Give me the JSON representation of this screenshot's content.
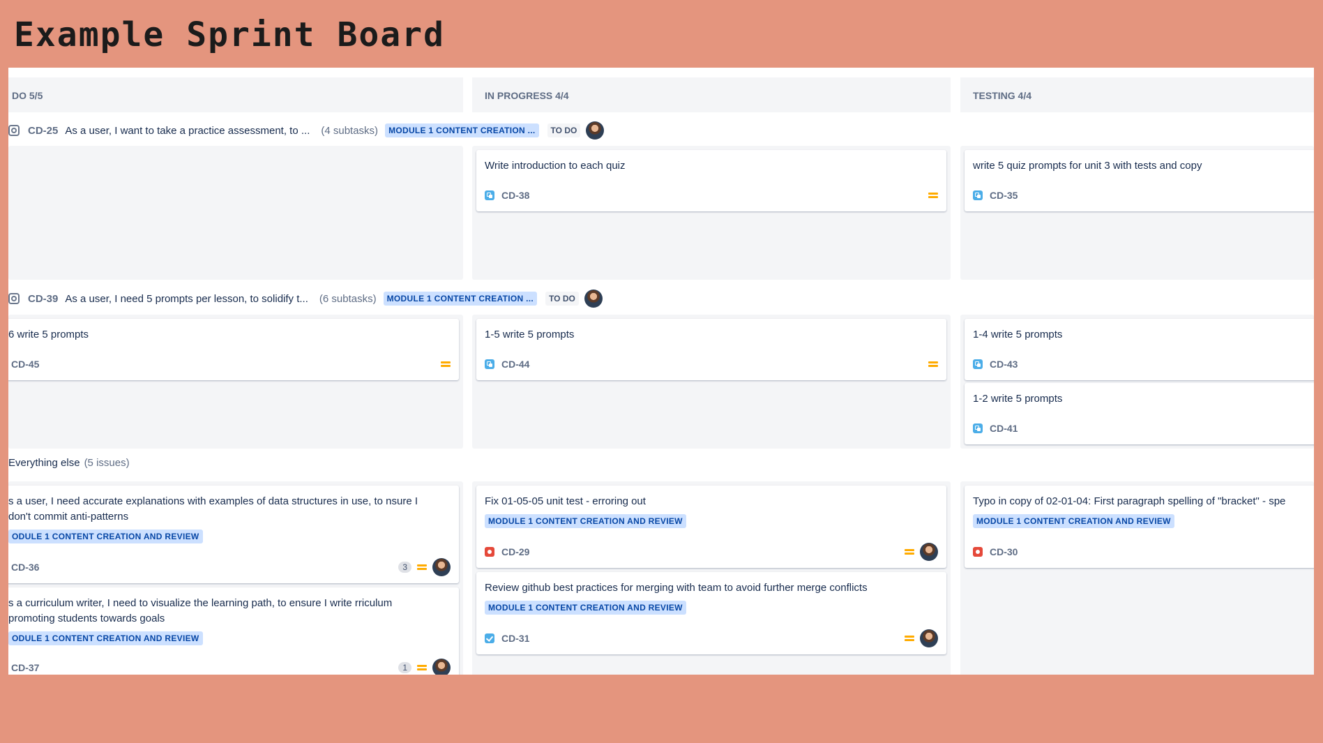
{
  "slide_title": "Example Sprint Board",
  "columns": [
    {
      "label": "DO 5/5"
    },
    {
      "label": "IN PROGRESS 4/4"
    },
    {
      "label": "TESTING 4/4"
    }
  ],
  "swimlanes": [
    {
      "key": "CD-25",
      "summary": "As a user, I want to take a practice assessment, to ...",
      "subtasks": "(4 subtasks)",
      "epic": "MODULE 1 CONTENT CREATION ...",
      "status": "TO DO",
      "icon": "story-icon"
    },
    {
      "key": "CD-39",
      "summary": "As a user, I need 5 prompts per lesson, to solidify t...",
      "subtasks": "(6 subtasks)",
      "epic": "MODULE 1 CONTENT CREATION ...",
      "status": "TO DO",
      "icon": "story-icon"
    }
  ],
  "everything_else": {
    "label": "Everything else",
    "count": "(5 issues)"
  },
  "cards": {
    "cd38": {
      "title": "Write introduction to each quiz",
      "key": "CD-38"
    },
    "cd35": {
      "title": "write 5 quiz prompts for unit 3 with tests and copy",
      "key": "CD-35"
    },
    "cd45": {
      "title": "6 write 5 prompts",
      "key": "CD-45"
    },
    "cd44": {
      "title": "1-5 write 5 prompts",
      "key": "CD-44"
    },
    "cd43": {
      "title": "1-4 write 5 prompts",
      "key": "CD-43"
    },
    "cd41": {
      "title": "1-2 write 5 prompts",
      "key": "CD-41"
    },
    "cd36": {
      "title": "s a user, I need accurate explanations with examples of data structures in use, to nsure I don't commit anti-patterns",
      "epic": "ODULE 1 CONTENT CREATION AND REVIEW",
      "key": "CD-36",
      "estimate": "3"
    },
    "cd37": {
      "title": "s a curriculum writer, I need to visualize the learning path, to ensure I write rriculum promoting students towards goals",
      "epic": "ODULE 1 CONTENT CREATION AND REVIEW",
      "key": "CD-37",
      "estimate": "1"
    },
    "cd29": {
      "title": "Fix 01-05-05 unit test - erroring out",
      "epic": "MODULE 1 CONTENT CREATION AND REVIEW",
      "key": "CD-29"
    },
    "cd31": {
      "title": "Review github best practices for merging with team to avoid further merge conflicts",
      "epic": "MODULE 1 CONTENT CREATION AND REVIEW",
      "key": "CD-31"
    },
    "cd30": {
      "title": "Typo in copy of 02-01-04: First paragraph spelling of \"bracket\" - spe",
      "epic": "MODULE 1 CONTENT CREATION AND REVIEW",
      "key": "CD-30"
    }
  },
  "colors": {
    "background": "#e4957e",
    "epic_bg": "#cce0ff",
    "epic_text": "#0747a6",
    "priority": "#ffab00"
  }
}
